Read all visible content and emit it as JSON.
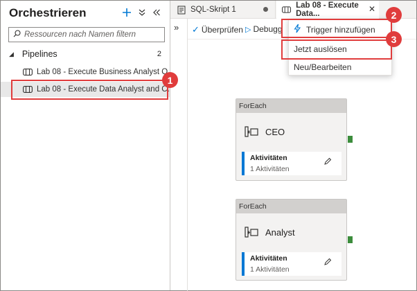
{
  "sidebar": {
    "title": "Orchestrieren",
    "search_placeholder": "Ressourcen nach Namen filtern",
    "pipelines_label": "Pipelines",
    "pipelines_count": "2",
    "items": [
      {
        "label": "Lab 08 - Execute Business Analyst Q..."
      },
      {
        "label": "Lab 08 - Execute Data Analyst and C..."
      }
    ]
  },
  "tabs": [
    {
      "label": "SQL-Skript 1"
    },
    {
      "label": "Lab 08 - Execute Data..."
    }
  ],
  "toolbar": {
    "validate": "Überprüfen",
    "debug": "Debugg"
  },
  "menu": {
    "items": [
      "Trigger hinzufügen",
      "Jetzt auslösen",
      "Neu/Bearbeiten"
    ]
  },
  "nodes": [
    {
      "type": "ForEach",
      "name": "CEO",
      "sub_title": "Aktivitäten",
      "sub_count": "1 Aktivitäten"
    },
    {
      "type": "ForEach",
      "name": "Analyst",
      "sub_title": "Aktivitäten",
      "sub_count": "1 Aktivitäten"
    }
  ],
  "callouts": [
    "1",
    "2",
    "3"
  ],
  "colors": {
    "accent": "#0078d4",
    "callout": "#e03c3c",
    "port": "#3c8d3c"
  }
}
